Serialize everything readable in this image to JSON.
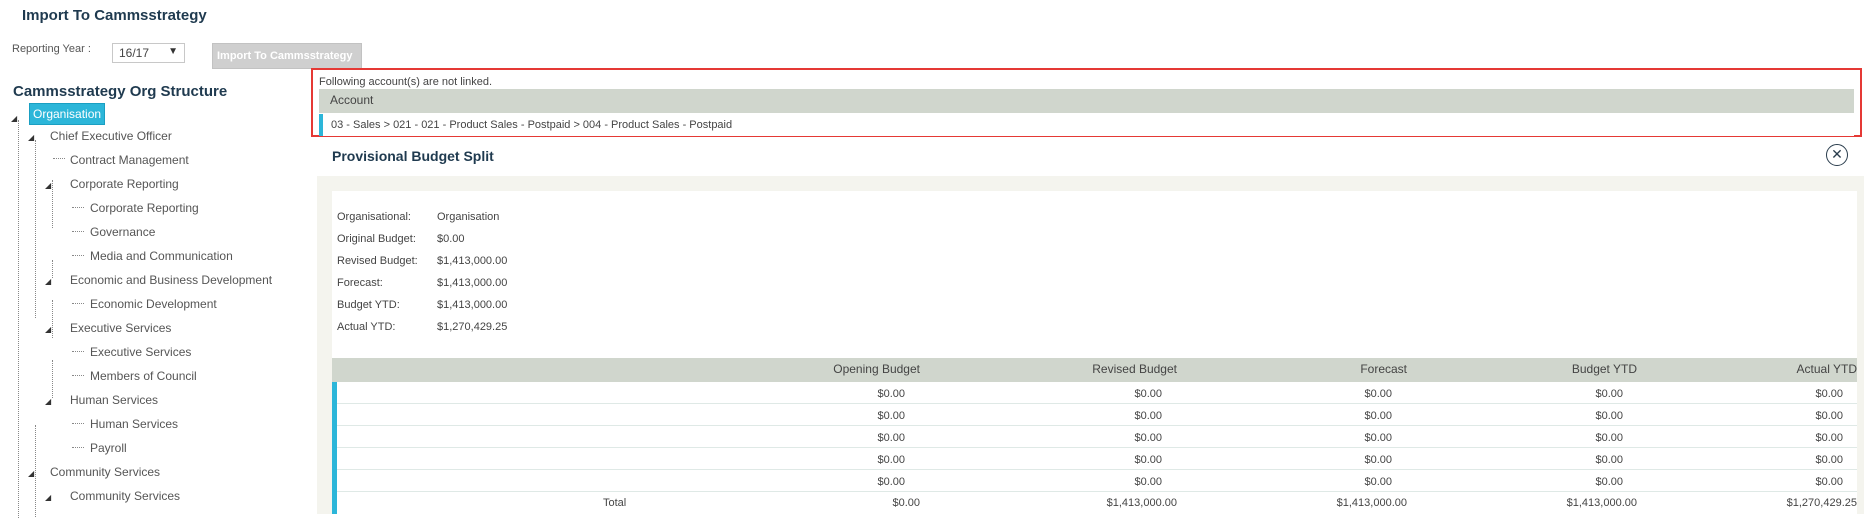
{
  "header": {
    "title": "Import To Cammsstrategy",
    "reporting_year_label": "Reporting Year :",
    "reporting_year_value": "16/17",
    "import_button": "Import To Cammsstrategy"
  },
  "org_structure": {
    "title": "Cammsstrategy Org Structure",
    "nodes": [
      {
        "label": "Organisation",
        "level": 0,
        "selected": true
      },
      {
        "label": "Chief Executive Officer",
        "level": 1
      },
      {
        "label": "Contract Management",
        "level": 2
      },
      {
        "label": "Corporate Reporting",
        "level": 2
      },
      {
        "label": "Corporate Reporting",
        "level": 3
      },
      {
        "label": "Governance",
        "level": 3
      },
      {
        "label": "Media and Communication",
        "level": 3
      },
      {
        "label": "Economic and Business Development",
        "level": 2
      },
      {
        "label": "Economic Development",
        "level": 3
      },
      {
        "label": "Executive Services",
        "level": 2
      },
      {
        "label": "Executive Services",
        "level": 3
      },
      {
        "label": "Members of Council",
        "level": 3
      },
      {
        "label": "Human Services",
        "level": 2
      },
      {
        "label": "Human Services",
        "level": 3
      },
      {
        "label": "Payroll",
        "level": 3
      },
      {
        "label": "Community Services",
        "level": 1
      },
      {
        "label": "Community Services",
        "level": 2
      }
    ]
  },
  "unlinked": {
    "message": "Following account(s) are not linked.",
    "column_header": "Account",
    "accounts": [
      "03 - Sales > 021 - 021 - Product Sales - Postpaid > 004 - Product Sales - Postpaid"
    ]
  },
  "provisional_budget": {
    "title": "Provisional Budget Split",
    "summary": [
      {
        "label": "Organisational:",
        "value": "Organisation"
      },
      {
        "label": "Original Budget:",
        "value": "$0.00"
      },
      {
        "label": "Revised Budget:",
        "value": "$1,413,000.00"
      },
      {
        "label": "Forecast:",
        "value": "$1,413,000.00"
      },
      {
        "label": "Budget YTD:",
        "value": "$1,413,000.00"
      },
      {
        "label": "Actual YTD:",
        "value": "$1,270,429.25"
      }
    ],
    "columns": [
      "Opening Budget",
      "Revised Budget",
      "Forecast",
      "Budget YTD",
      "Actual YTD"
    ],
    "rows": [
      [
        "$0.00",
        "$0.00",
        "$0.00",
        "$0.00",
        "$0.00"
      ],
      [
        "$0.00",
        "$0.00",
        "$0.00",
        "$0.00",
        "$0.00"
      ],
      [
        "$0.00",
        "$0.00",
        "$0.00",
        "$0.00",
        "$0.00"
      ],
      [
        "$0.00",
        "$0.00",
        "$0.00",
        "$0.00",
        "$0.00"
      ],
      [
        "$0.00",
        "$0.00",
        "$0.00",
        "$0.00",
        "$0.00"
      ]
    ],
    "total_label": "Total",
    "totals": [
      "$0.00",
      "$1,413,000.00",
      "$1,413,000.00",
      "$1,413,000.00",
      "$1,270,429.25"
    ]
  },
  "icons": {
    "close": "close-circle-icon",
    "dropdown": "chevron-down-icon",
    "expand": "tree-collapse-icon"
  },
  "colors": {
    "accent": "#2cb6d9",
    "highlight_border": "#e53935",
    "header_bg": "#d0d6cd",
    "title": "#1f3a4f"
  }
}
